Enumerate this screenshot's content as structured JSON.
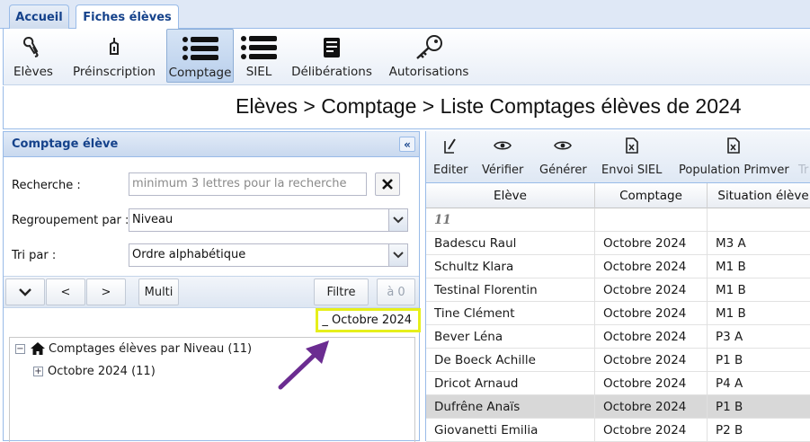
{
  "tabs": [
    {
      "label": "Accueil",
      "active": false
    },
    {
      "label": "Fiches élèves",
      "active": true
    }
  ],
  "ribbon": [
    {
      "label": "Elèves",
      "icon": "students-icon"
    },
    {
      "label": "Préinscription",
      "icon": "pen-nib-icon"
    },
    {
      "label": "Comptage",
      "icon": "list-icon",
      "active": true
    },
    {
      "label": "SIEL",
      "icon": "list-icon"
    },
    {
      "label": "Délibérations",
      "icon": "document-icon"
    },
    {
      "label": "Autorisations",
      "icon": "key-icon"
    }
  ],
  "breadcrumb": "Elèves > Comptage > Liste Comptages élèves de 2024",
  "left_panel": {
    "title": "Comptage élève",
    "search": {
      "label": "Recherche :",
      "placeholder": "minimum 3 lettres pour la recherche"
    },
    "grouping": {
      "label": "Regroupement par :",
      "value": "Niveau"
    },
    "sort": {
      "label": "Tri par :",
      "value": "Ordre alphabétique"
    },
    "buttons": {
      "expand": "⌄",
      "prev": "<",
      "next": ">",
      "multi": "Multi",
      "filter": "Filtre",
      "reset": "à 0"
    },
    "highlight_label": "_ Octobre 2024",
    "tree": {
      "root": "Comptages élèves par Niveau (11)",
      "child": "Octobre 2024 (11)"
    }
  },
  "toolbar": [
    {
      "label": "Editer",
      "icon": "edit-icon"
    },
    {
      "label": "Vérifier",
      "icon": "eye-icon"
    },
    {
      "label": "Générer",
      "icon": "eye-icon"
    },
    {
      "label": "Envoi SIEL",
      "icon": "excel-icon"
    },
    {
      "label": "Population Primver",
      "icon": "excel-icon"
    },
    {
      "label": "Tr",
      "icon": "",
      "disabled": true
    }
  ],
  "grid": {
    "columns": [
      "Elève",
      "Comptage",
      "Situation élève"
    ],
    "group_label": "11",
    "rows": [
      {
        "eleve": "Badescu Raul",
        "comptage": "Octobre 2024",
        "situation": "M3 A"
      },
      {
        "eleve": "Schultz Klara",
        "comptage": "Octobre 2024",
        "situation": "M1 B"
      },
      {
        "eleve": "Testinal Florentin",
        "comptage": "Octobre 2024",
        "situation": "M1 B"
      },
      {
        "eleve": "Tine Clément",
        "comptage": "Octobre 2024",
        "situation": "M1 B"
      },
      {
        "eleve": "Bever Léna",
        "comptage": "Octobre 2024",
        "situation": "P3 A"
      },
      {
        "eleve": "De Boeck Achille",
        "comptage": "Octobre 2024",
        "situation": "P1 B"
      },
      {
        "eleve": "Dricot Arnaud",
        "comptage": "Octobre 2024",
        "situation": "P4 A"
      },
      {
        "eleve": "Dufrêne Anaïs",
        "comptage": "Octobre 2024",
        "situation": "P1 B",
        "selected": true
      },
      {
        "eleve": "Giovanetti Emilia",
        "comptage": "Octobre 2024",
        "situation": "P2 B"
      }
    ]
  },
  "colors": {
    "accent": "#15428b",
    "border": "#99bbe8",
    "highlight": "#e6ef1a",
    "arrow": "#6b2c91"
  }
}
